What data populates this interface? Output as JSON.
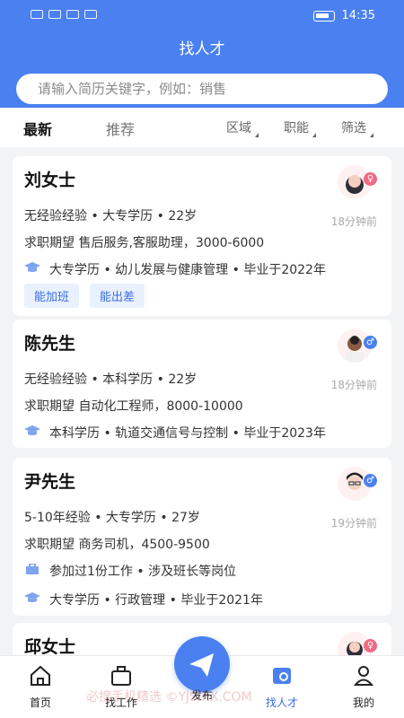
{
  "status_bar": {
    "time": "14:35"
  },
  "header": {
    "title": "找人才"
  },
  "search": {
    "placeholder": "请输入简历关键字，例如：销售"
  },
  "tabs": {
    "latest": "最新",
    "recommend": "推荐"
  },
  "filters": {
    "region": "区域",
    "skill": "职能",
    "filter": "筛选"
  },
  "cards": [
    {
      "name": "刘女士",
      "line1": "无经验经验 • 大专学历 • 22岁",
      "line2": "求职期望 售后服务,客服助理，3000-6000",
      "line3": "大专学历 • 幼儿发展与健康管理 • 毕业于2022年",
      "time": "18分钟前",
      "tags": [
        "能加班",
        "能出差"
      ],
      "gender_icon": "female-icon"
    },
    {
      "name": "陈先生",
      "line1": "无经验经验 • 本科学历 • 22岁",
      "line2": "求职期望 自动化工程师，8000-10000",
      "line3": "本科学历 • 轨道交通信号与控制 • 毕业于2023年",
      "time": "18分钟前",
      "gender_icon": "male-icon"
    },
    {
      "name": "尹先生",
      "line1": "5-10年经验 • 大专学历 • 27岁",
      "line2": "求职期望 商务司机，4500-9500",
      "line3": "参加过1份工作 • 涉及班长等岗位",
      "line4": "大专学历 • 行政管理 • 毕业于2021年",
      "time": "19分钟前",
      "gender_icon": "male-icon"
    },
    {
      "name": "邱女士",
      "gender_icon": "female-icon"
    }
  ],
  "bottom_nav": {
    "home": "首页",
    "jobs": "找工作",
    "publish": "发布",
    "talent": "找人才",
    "mine": "我的"
  },
  "watermark": "必搜手机精选 ©YJSIXX.COM",
  "colors": {
    "primary": "#4a80f0",
    "tag_bg": "#e9f1ff",
    "female": "#f06a82",
    "male": "#4a80f0"
  }
}
